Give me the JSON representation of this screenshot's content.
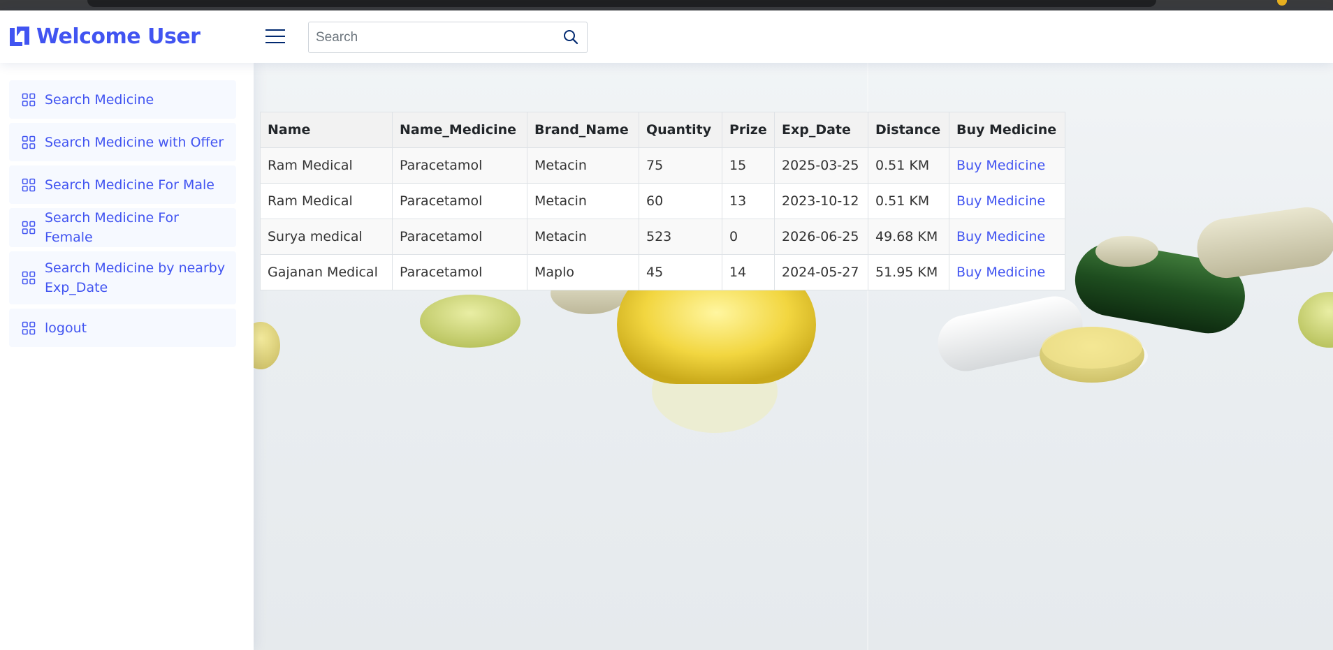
{
  "header": {
    "brand": "Welcome User",
    "search_placeholder": "Search",
    "search_value": ""
  },
  "sidebar": {
    "items": [
      {
        "label": "Search Medicine"
      },
      {
        "label": "Search Medicine with Offer"
      },
      {
        "label": "Search Medicine For Male"
      },
      {
        "label": "Search Medicine For Female"
      },
      {
        "label": "Search Medicine by nearby Exp_Date"
      },
      {
        "label": "logout"
      }
    ]
  },
  "table": {
    "headers": [
      "Name",
      "Name_Medicine",
      "Brand_Name",
      "Quantity",
      "Prize",
      "Exp_Date",
      "Distance",
      "Buy Medicine"
    ],
    "rows": [
      {
        "name": "Ram Medical",
        "medicine": "Paracetamol",
        "brand": "Metacin",
        "quantity": "75",
        "prize": "15",
        "exp_date": "2025-03-25",
        "distance": "0.51 KM",
        "action": "Buy Medicine"
      },
      {
        "name": "Ram Medical",
        "medicine": "Paracetamol",
        "brand": "Metacin",
        "quantity": "60",
        "prize": "13",
        "exp_date": "2023-10-12",
        "distance": "0.51 KM",
        "action": "Buy Medicine"
      },
      {
        "name": "Surya medical",
        "medicine": "Paracetamol",
        "brand": "Metacin",
        "quantity": "523",
        "prize": "0",
        "exp_date": "2026-06-25",
        "distance": "49.68 KM",
        "action": "Buy Medicine"
      },
      {
        "name": "Gajanan Medical",
        "medicine": "Paracetamol",
        "brand": "Maplo",
        "quantity": "45",
        "prize": "14",
        "exp_date": "2024-05-27",
        "distance": "51.95 KM",
        "action": "Buy Medicine"
      }
    ]
  },
  "colors": {
    "accent": "#4154f1",
    "nav_bg": "#f6f9ff",
    "header_icon": "#012970"
  },
  "icons": {
    "logo": "logo-icon",
    "menu": "hamburger-menu-icon",
    "search": "search-icon",
    "nav": "grid-icon"
  }
}
